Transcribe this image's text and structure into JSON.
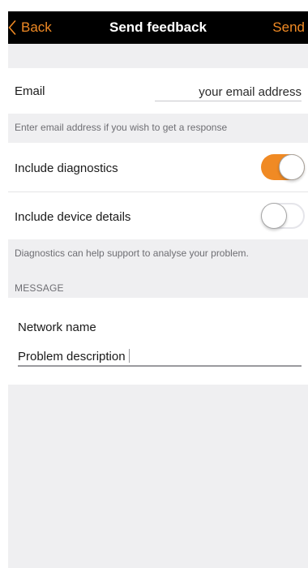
{
  "nav": {
    "back_label": "Back",
    "title": "Send feedback",
    "send_label": "Send",
    "accent_color": "#f08a24"
  },
  "email": {
    "label": "Email",
    "value": "",
    "placeholder": "your email address",
    "hint": "Enter email address if you wish to get a response"
  },
  "diagnostics": {
    "label": "Include diagnostics",
    "enabled": true
  },
  "device_details": {
    "label": "Include device details",
    "enabled": false
  },
  "diagnostics_hint": "Diagnostics can help support to analyse your problem.",
  "message": {
    "section_header": "MESSAGE",
    "network_label": "Network name",
    "problem_value": "Problem description"
  }
}
